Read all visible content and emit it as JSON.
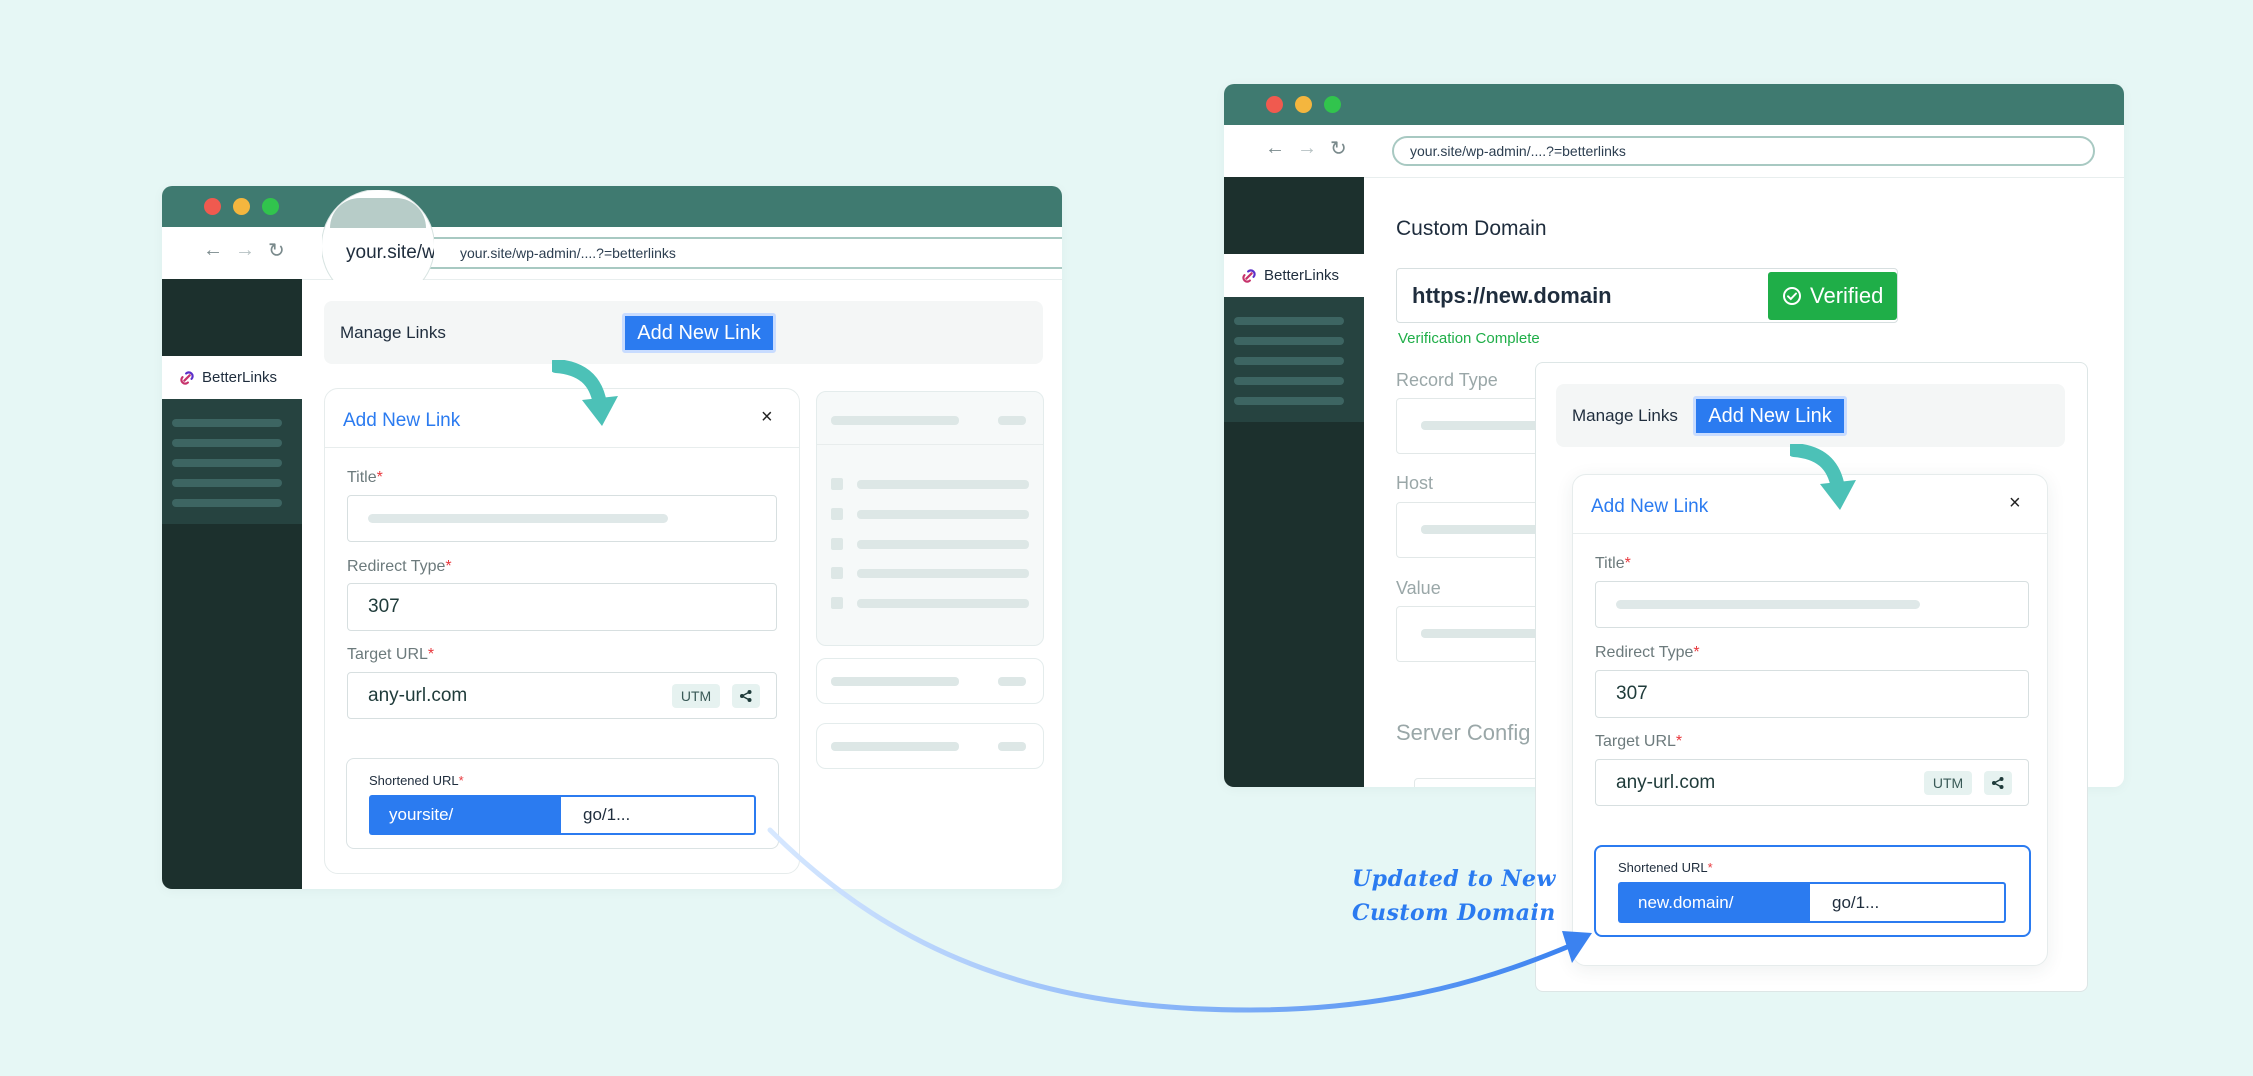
{
  "left": {
    "url": "your.site/wp-admin/....?=betterlinks",
    "magnifier_text": "your.site/w",
    "brand": "BetterLinks",
    "toolbar": {
      "manage": "Manage Links",
      "add": "Add New Link"
    },
    "panel": {
      "title": "Add New Link",
      "close": "×",
      "title_label": "Title",
      "redirect_label": "Redirect Type",
      "redirect_value": "307",
      "target_label": "Target URL",
      "target_value": "any-url.com",
      "utm": "UTM",
      "short_label": "Shortened URL",
      "short_prefix": "yoursite/",
      "short_slug": "go/1..."
    },
    "required_mark": "*"
  },
  "right": {
    "url": "your.site/wp-admin/....?=betterlinks",
    "brand": "BetterLinks",
    "custom_domain_title": "Custom Domain",
    "domain_value": "https://new.domain",
    "verified": "Verified",
    "verification_text": "Verification Complete",
    "record_type": "Record Type",
    "host": "Host",
    "value": "Value",
    "server_config": "Server Config",
    "toolbar": {
      "manage": "Manage Links",
      "add": "Add New Link"
    },
    "panel": {
      "title": "Add New Link",
      "close": "×",
      "title_label": "Title",
      "redirect_label": "Redirect Type",
      "redirect_value": "307",
      "target_label": "Target URL",
      "target_value": "any-url.com",
      "utm": "UTM",
      "short_label": "Shortened URL",
      "short_prefix": "new.domain/",
      "short_slug": "go/1..."
    }
  },
  "annotation": {
    "line1": "Updated to New",
    "line2": "Custom Domain"
  },
  "colors": {
    "background": "#e6f7f5",
    "titlebar": "#3f7a70",
    "sidebar": "#1c302d",
    "accent": "#2b7bf0",
    "verified": "#1fae48",
    "arrow_teal": "#4cc1b7"
  }
}
